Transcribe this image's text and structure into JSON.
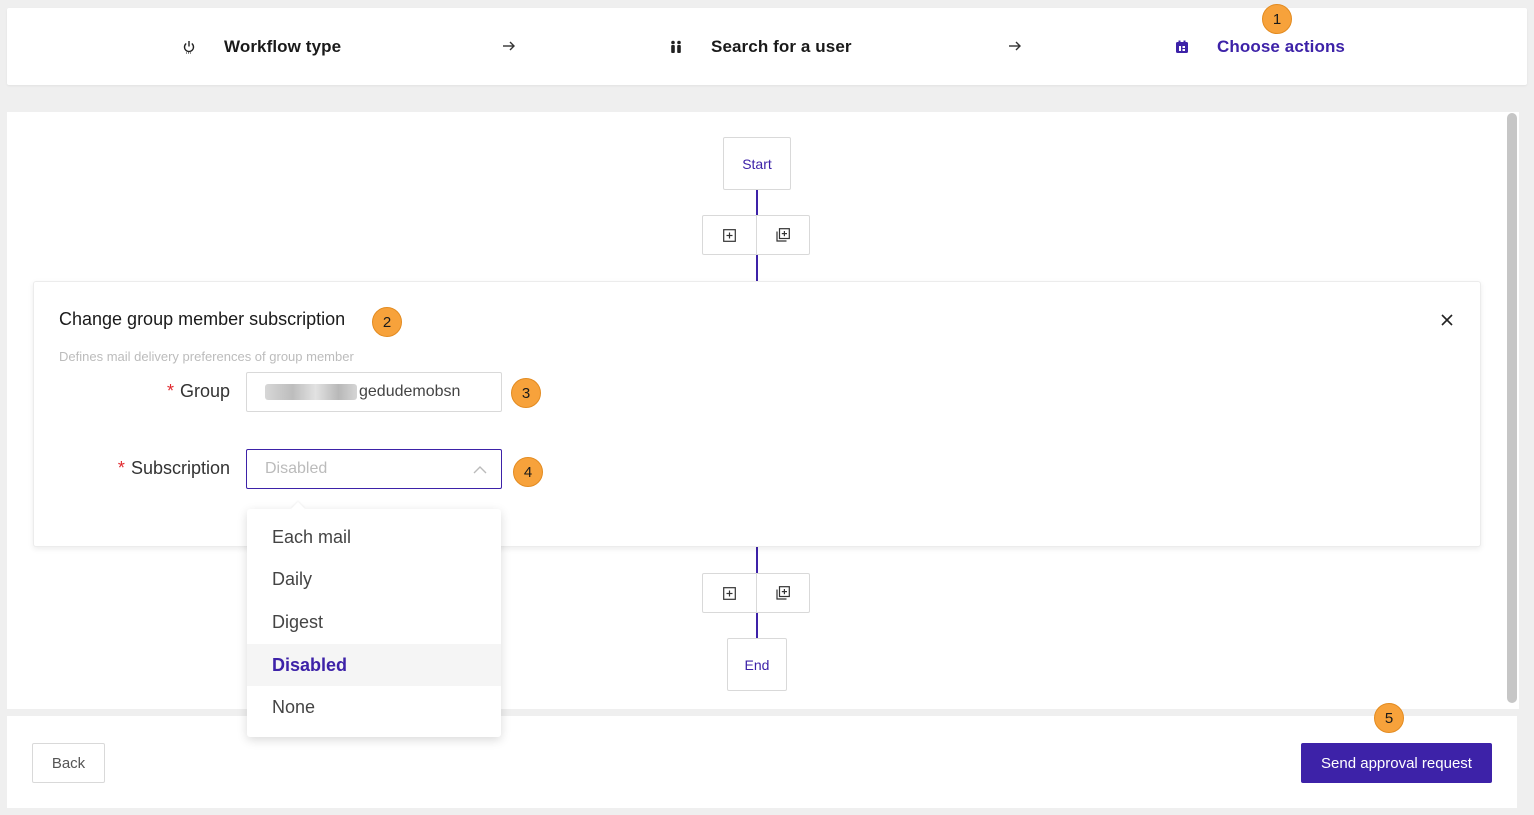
{
  "stepper": {
    "steps": [
      {
        "label": "Workflow type",
        "icon": "power-icon"
      },
      {
        "label": "Search for a user",
        "icon": "users-icon"
      },
      {
        "label": "Choose actions",
        "icon": "actions-icon"
      }
    ],
    "active_color": "#3d22a8"
  },
  "badges": [
    "1",
    "2",
    "3",
    "4",
    "5"
  ],
  "workflow": {
    "start_label": "Start",
    "end_label": "End"
  },
  "action_card": {
    "title": "Change group member subscription",
    "subtitle": "Defines mail delivery preferences of group member",
    "group": {
      "label": "Group",
      "value_suffix": "gedudemobsn"
    },
    "subscription": {
      "label": "Subscription",
      "value": "Disabled",
      "options": [
        "Each mail",
        "Daily",
        "Digest",
        "Disabled",
        "None"
      ],
      "selected": "Disabled"
    }
  },
  "footer": {
    "back_label": "Back",
    "send_label": "Send approval request"
  },
  "colors": {
    "accent": "#3d22a8",
    "badge": "#f7a23b",
    "required": "#e0282e"
  }
}
